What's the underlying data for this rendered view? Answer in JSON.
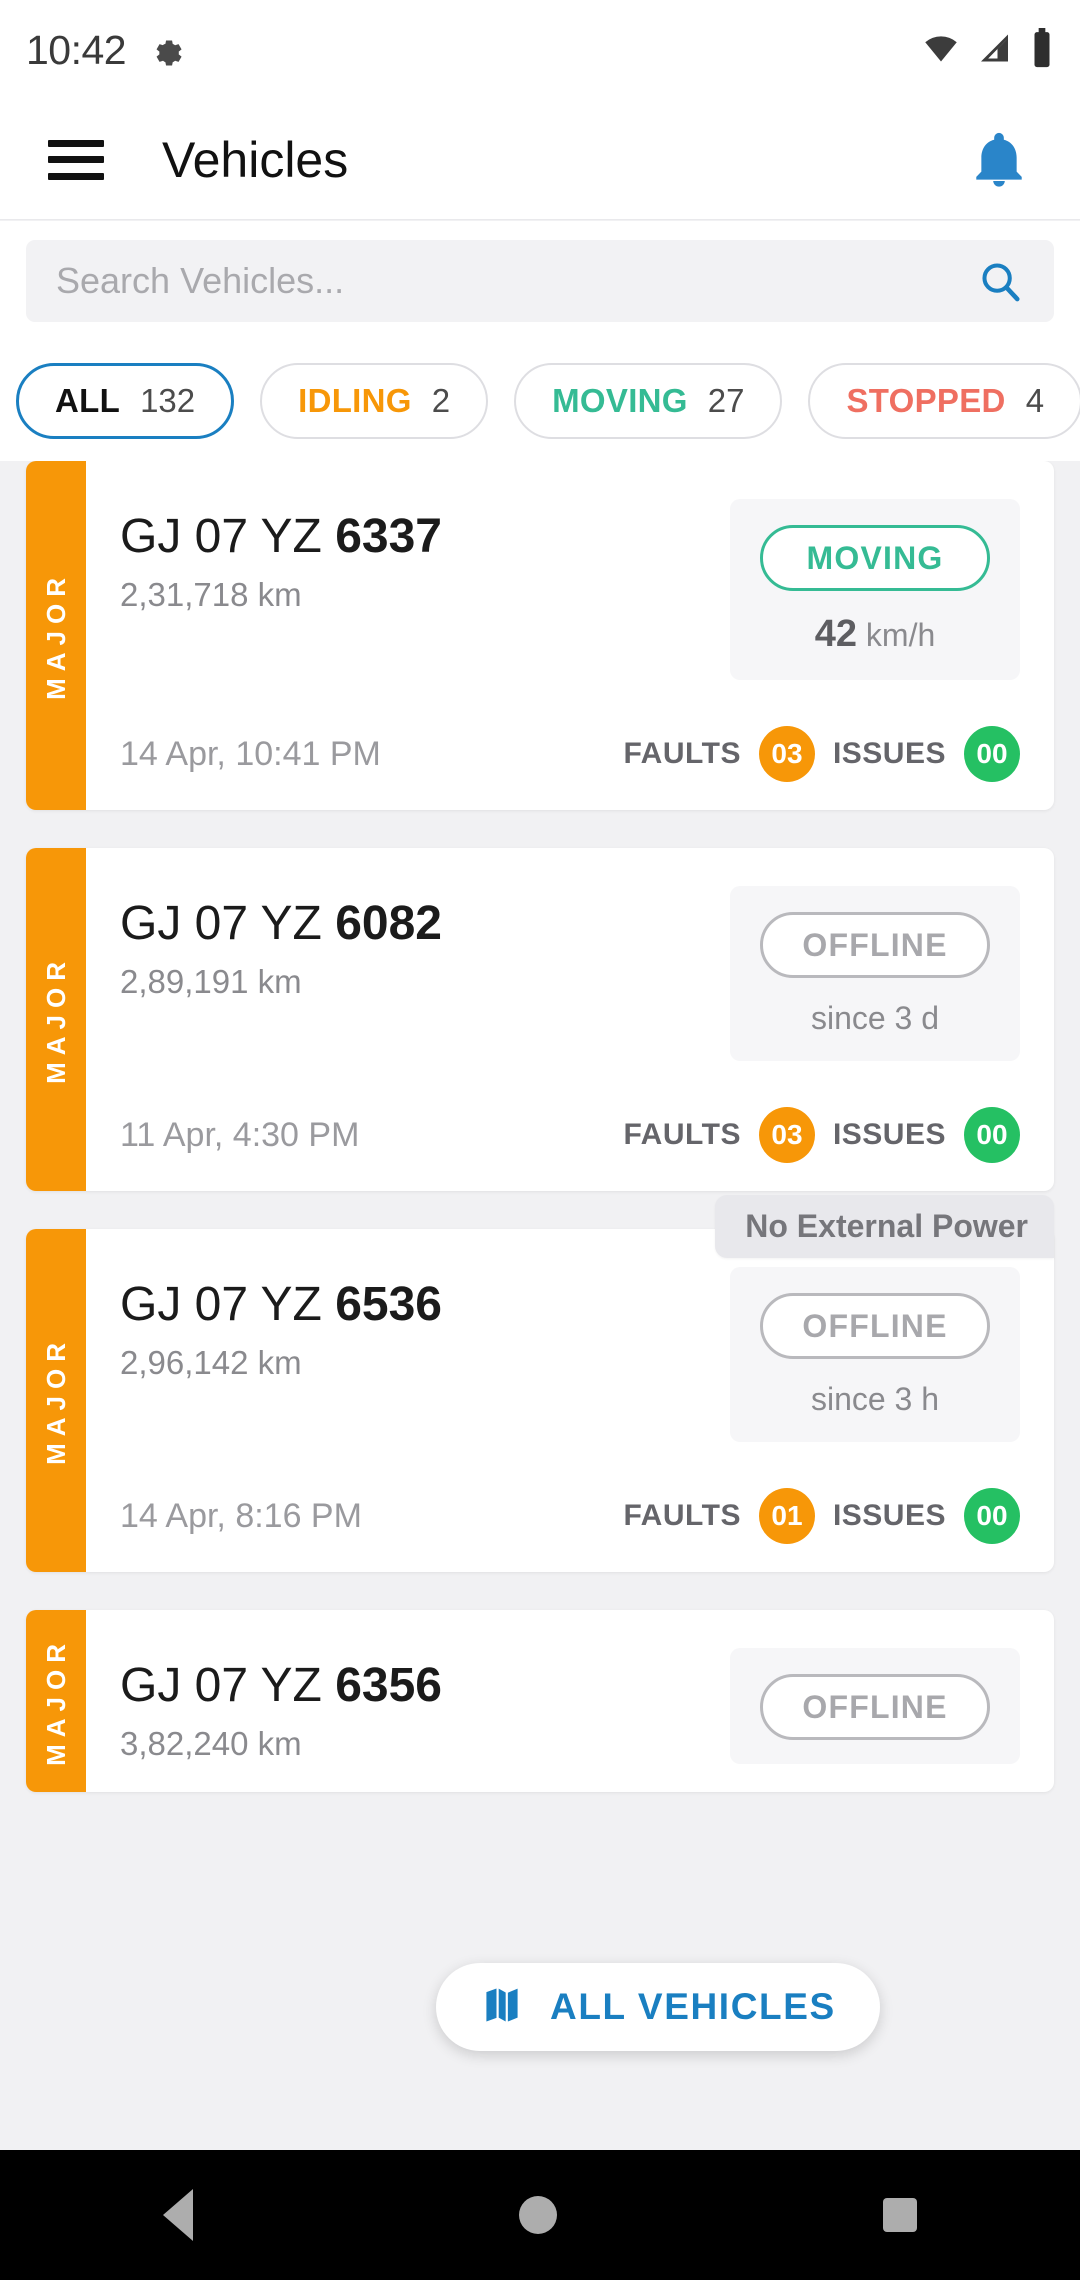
{
  "status_bar": {
    "time": "10:42",
    "icons": [
      "gear-icon",
      "wifi-icon",
      "signal-icon",
      "battery-icon"
    ]
  },
  "app_bar": {
    "title": "Vehicles",
    "menu_icon": "hamburger-menu-icon",
    "notification_icon": "bell-icon"
  },
  "search": {
    "placeholder": "Search Vehicles...",
    "value": "",
    "icon": "search-icon"
  },
  "filters": [
    {
      "label": "ALL",
      "count": "132",
      "color": "#111111",
      "active": true
    },
    {
      "label": "IDLING",
      "count": "2",
      "color": "#f79708",
      "active": false
    },
    {
      "label": "MOVING",
      "count": "27",
      "color": "#35bb94",
      "active": false
    },
    {
      "label": "STOPPED",
      "count": "4",
      "color": "#ef6f61",
      "active": false
    }
  ],
  "vehicles": [
    {
      "severity": "MAJOR",
      "plate_prefix": "GJ 07 YZ ",
      "plate_number": "6337",
      "odometer": "2,31,718 km",
      "status": "MOVING",
      "status_type": "moving",
      "status_sub_value": "42",
      "status_sub_unit": " km/h",
      "timestamp": "14 Apr, 10:41 PM",
      "faults_label": "FAULTS",
      "faults_count": "03",
      "issues_label": "ISSUES",
      "issues_count": "00",
      "badge": ""
    },
    {
      "severity": "MAJOR",
      "plate_prefix": "GJ 07 YZ ",
      "plate_number": "6082",
      "odometer": "2,89,191 km",
      "status": "OFFLINE",
      "status_type": "offline",
      "status_sub_value": "",
      "status_sub_unit": "since 3 d",
      "timestamp": "11 Apr, 4:30 PM",
      "faults_label": "FAULTS",
      "faults_count": "03",
      "issues_label": "ISSUES",
      "issues_count": "00",
      "badge": ""
    },
    {
      "severity": "MAJOR",
      "plate_prefix": "GJ 07 YZ ",
      "plate_number": "6536",
      "odometer": "2,96,142 km",
      "status": "OFFLINE",
      "status_type": "offline",
      "status_sub_value": "",
      "status_sub_unit": "since 3 h",
      "timestamp": "14 Apr, 8:16 PM",
      "faults_label": "FAULTS",
      "faults_count": "01",
      "issues_label": "ISSUES",
      "issues_count": "00",
      "badge": "No External Power"
    },
    {
      "severity": "MAJOR",
      "plate_prefix": "GJ 07 YZ ",
      "plate_number": "6356",
      "odometer": "3,82,240 km",
      "status": "OFFLINE",
      "status_type": "offline",
      "status_sub_value": "",
      "status_sub_unit": "",
      "timestamp": "",
      "faults_label": "",
      "faults_count": "",
      "issues_label": "",
      "issues_count": "",
      "badge": ""
    }
  ],
  "fab": {
    "label": "ALL VEHICLES",
    "icon": "map-icon",
    "color": "#1a7fc1"
  },
  "nav_bar": {
    "back": "back-triangle-icon",
    "home": "home-circle-icon",
    "recents": "recents-square-icon"
  },
  "colors": {
    "accent": "#1a7fc1",
    "severity_major": "#f79708",
    "moving": "#35bb94",
    "ok": "#25c063",
    "stopped": "#ef6f61"
  }
}
